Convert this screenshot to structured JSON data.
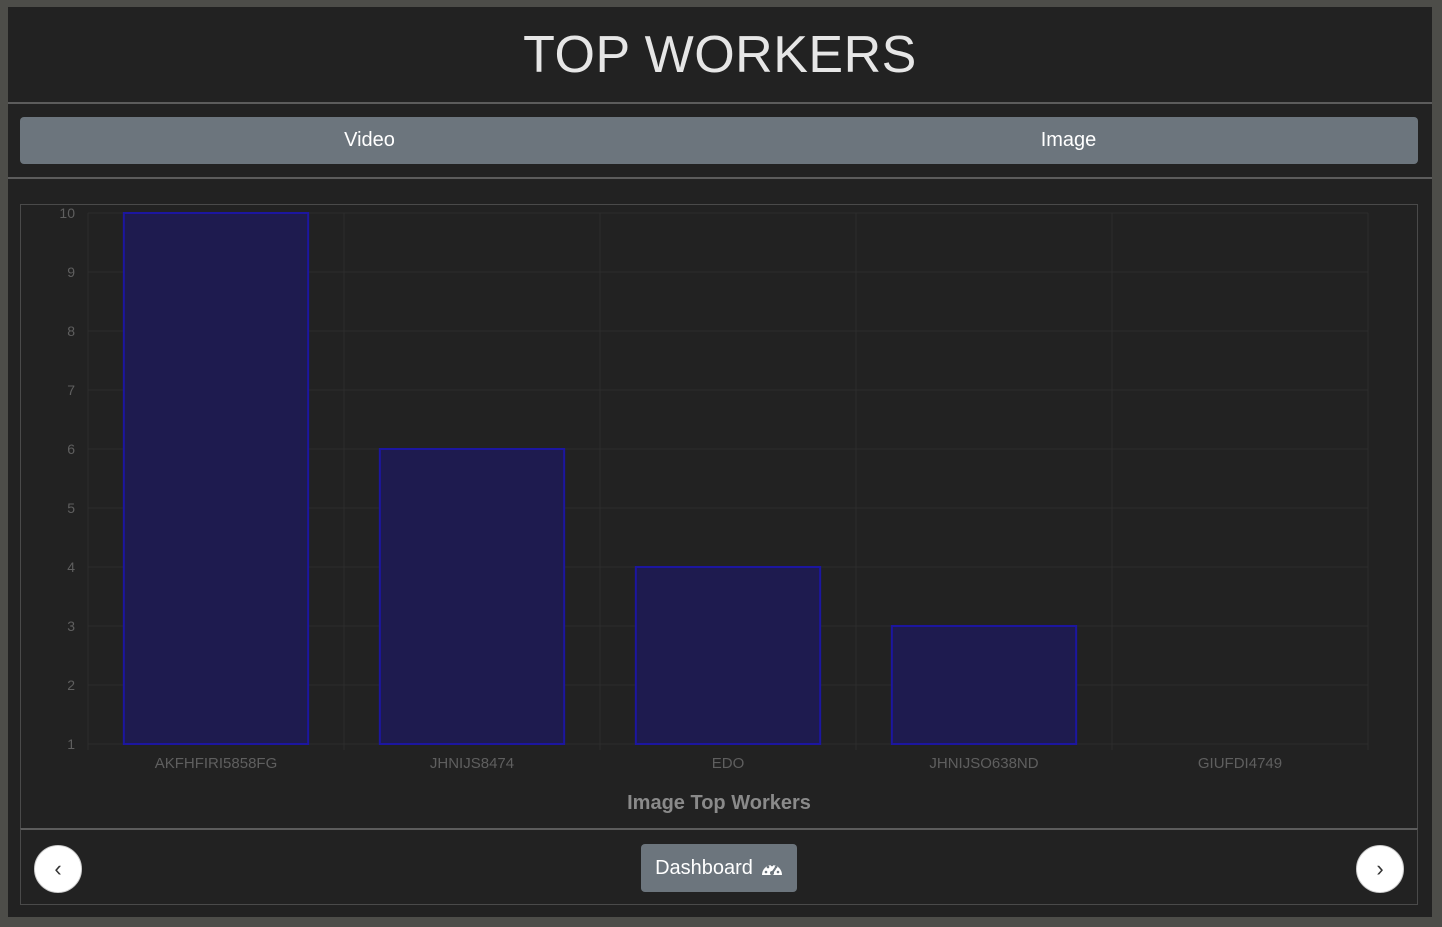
{
  "page": {
    "title": "TOP WORKERS"
  },
  "tabs": [
    {
      "label": "Video"
    },
    {
      "label": "Image"
    }
  ],
  "chart_data": {
    "type": "bar",
    "title": "Image Top Workers",
    "categories": [
      "AKFHFIRI5858FG",
      "JHNIJS8474",
      "EDO",
      "JHNIJSO638ND",
      "GIUFDI4749"
    ],
    "series": [
      {
        "values": [
          10,
          6,
          4,
          3,
          1
        ]
      }
    ],
    "xlabel": "",
    "ylabel": "",
    "ylim": [
      1,
      10
    ],
    "yticks": [
      1,
      2,
      3,
      4,
      5,
      6,
      7,
      8,
      9,
      10
    ],
    "grid": true,
    "colors": {
      "bar_fill": "#1e1b4f",
      "bar_border": "#1c16a0",
      "grid": "#2c2c2c",
      "tick_text": "#5f5f5f",
      "title_text": "#8a8a8a"
    }
  },
  "footer": {
    "prev_label": "‹",
    "next_label": "›",
    "dashboard_label": "Dashboard",
    "dashboard_icon": "gauge-icon"
  }
}
